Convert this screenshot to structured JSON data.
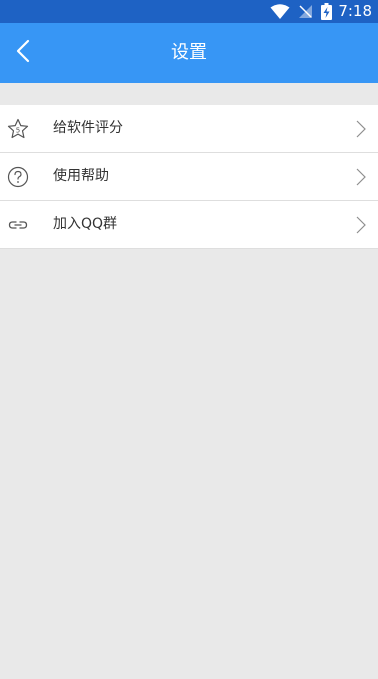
{
  "status_bar": {
    "time": "7:18",
    "icons": [
      "wifi-icon",
      "signal-off-icon",
      "battery-charging-icon"
    ]
  },
  "app_bar": {
    "title": "设置",
    "back_icon": "back-arrow-icon"
  },
  "settings": {
    "items": [
      {
        "label": "给软件评分",
        "icon": "star-rating-icon"
      },
      {
        "label": "使用帮助",
        "icon": "help-circle-icon"
      },
      {
        "label": "加入QQ群",
        "icon": "link-icon"
      }
    ]
  },
  "colors": {
    "status_bar": "#1e62c4",
    "app_bar": "#3796f5",
    "background": "#e9e9e9",
    "list_background": "#ffffff",
    "text": "#333333",
    "divider": "#dedede"
  }
}
